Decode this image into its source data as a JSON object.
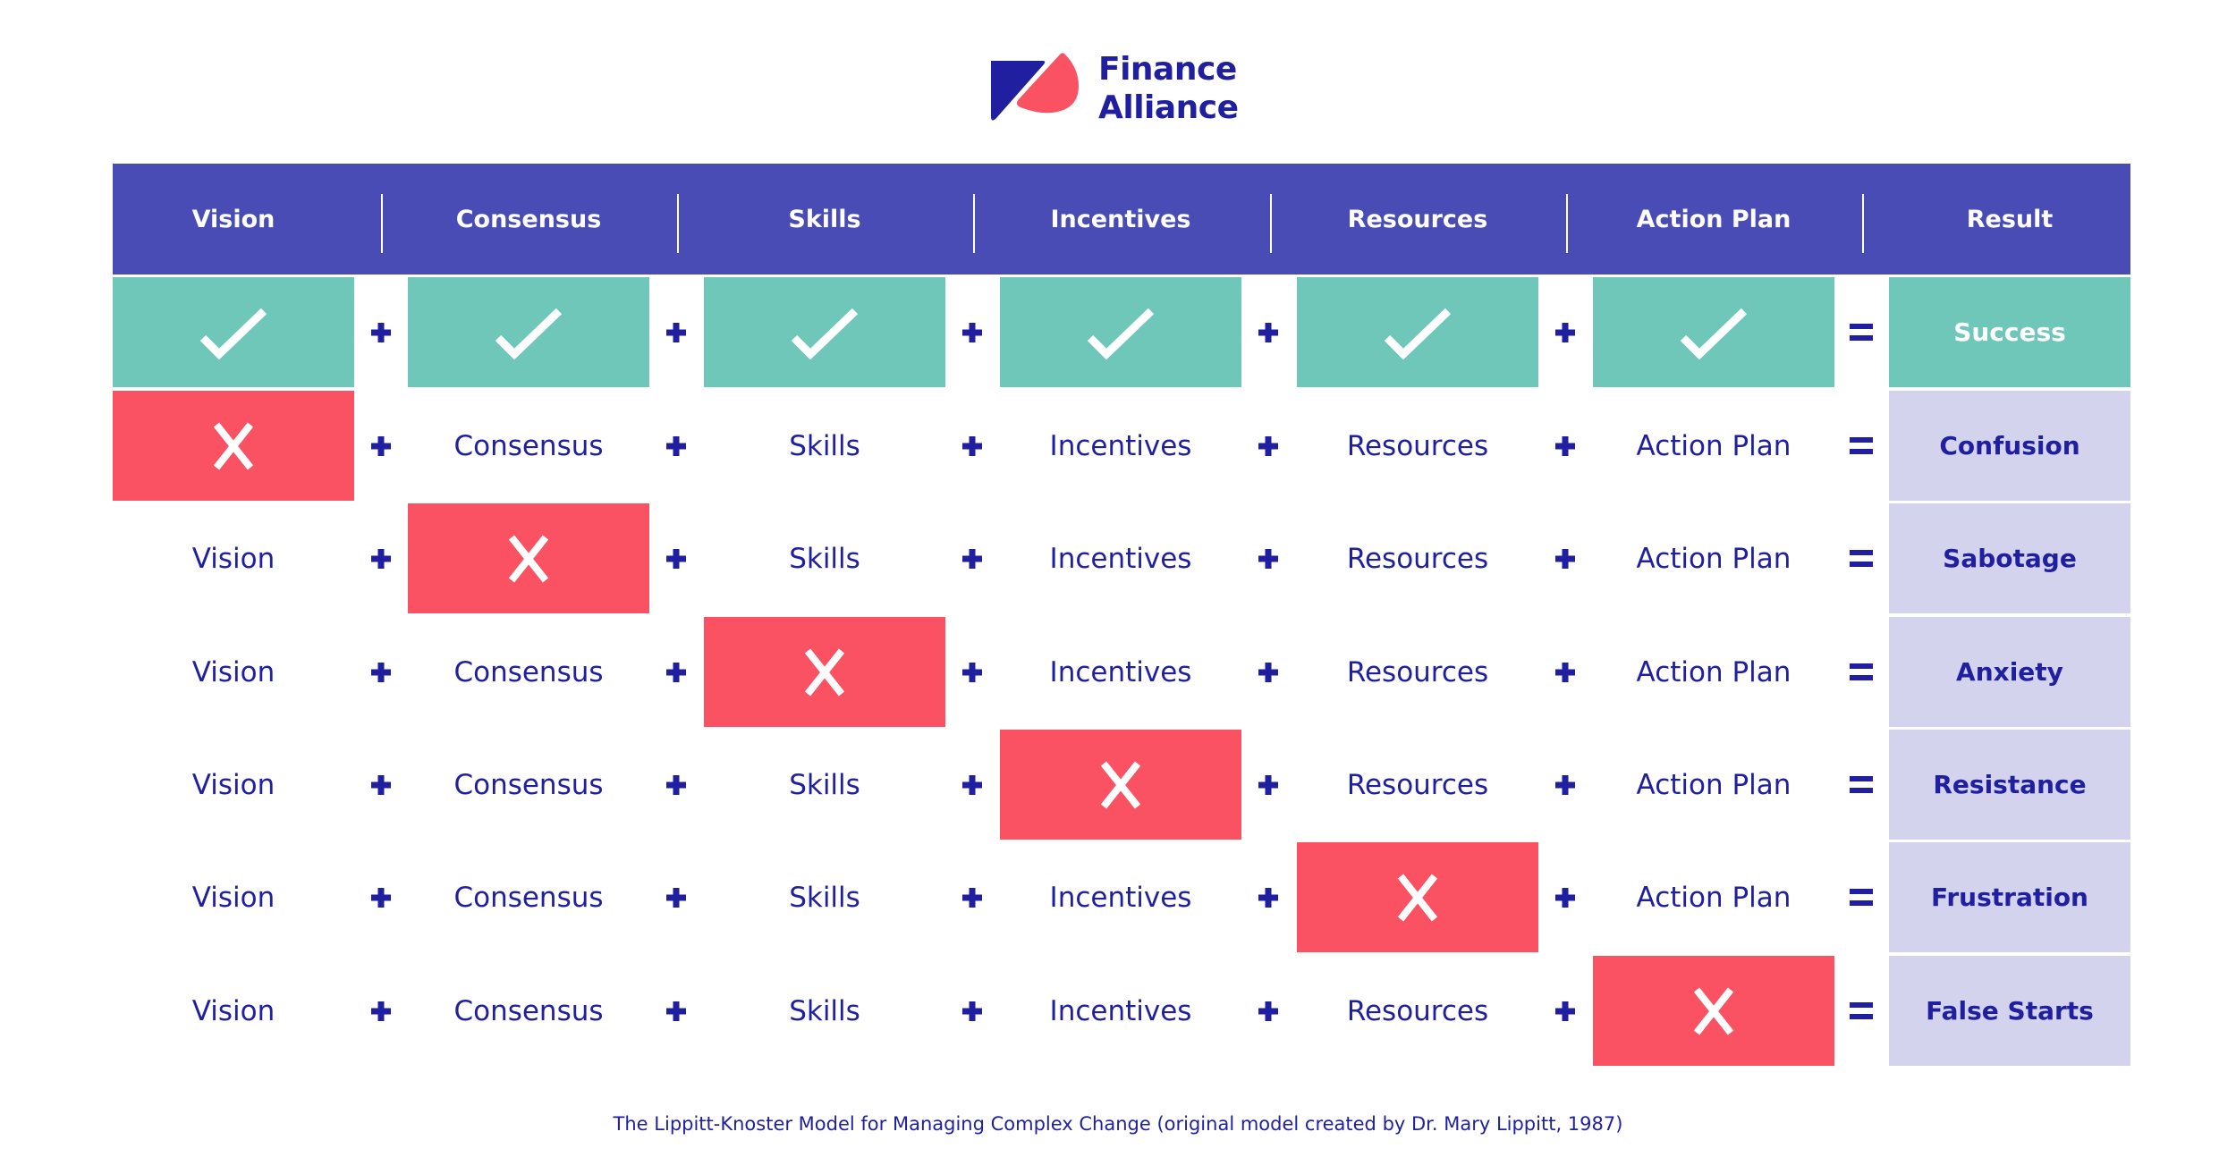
{
  "brand": {
    "name_line1": "Finance",
    "name_line2": "Alliance",
    "colors": {
      "navy": "#1f1fa0",
      "coral": "#fa5262"
    }
  },
  "colors": {
    "header_bg": "#4a4cb5",
    "success": "#6ec7b8",
    "fail": "#fa5262",
    "result_bg": "#d3d3ee",
    "text": "#1f1fa0"
  },
  "columns": [
    "Vision",
    "Consensus",
    "Skills",
    "Incentives",
    "Resources",
    "Action Plan",
    "Result"
  ],
  "operators": {
    "plus": "+",
    "equals": "="
  },
  "rows": [
    {
      "missing": null,
      "result": "Success"
    },
    {
      "missing": 0,
      "result": "Confusion"
    },
    {
      "missing": 1,
      "result": "Sabotage"
    },
    {
      "missing": 2,
      "result": "Anxiety"
    },
    {
      "missing": 3,
      "result": "Resistance"
    },
    {
      "missing": 4,
      "result": "Frustration"
    },
    {
      "missing": 5,
      "result": "False Starts"
    }
  ],
  "icons": {
    "present": "check-icon",
    "missing": "x-icon"
  },
  "caption": "The Lippitt-Knoster Model for Managing Complex Change (original model created by Dr. Mary Lippitt, 1987)"
}
